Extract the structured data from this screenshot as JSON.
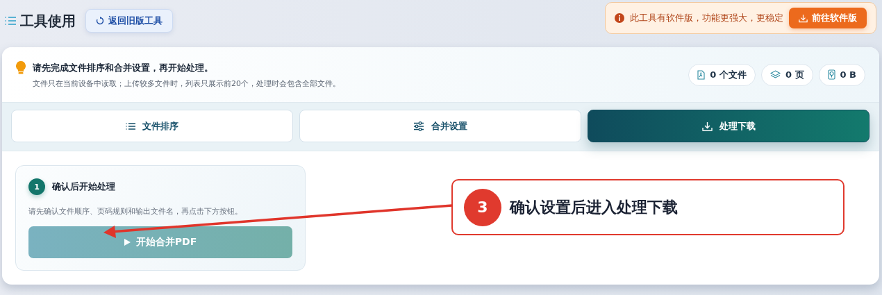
{
  "header": {
    "title": "工具使用",
    "back_button": "返回旧版工具",
    "notice": "此工具有软件版，功能更强大，更稳定",
    "notice_button": "前往软件版"
  },
  "intro": {
    "heading": "请先完成文件排序和合并设置，再开始处理。",
    "note": "文件只在当前设备中读取；上传较多文件时，列表只展示前20个，处理时会包含全部文件。",
    "stats": [
      {
        "kind": "files",
        "text": "0 个文件"
      },
      {
        "kind": "pages",
        "text": "0 页"
      },
      {
        "kind": "size",
        "text": "0 B"
      }
    ]
  },
  "tabs": [
    {
      "kind": "list",
      "label": "文件排序",
      "selected": false
    },
    {
      "kind": "sliders",
      "label": "合并设置",
      "selected": false
    },
    {
      "kind": "download",
      "label": "处理下载",
      "selected": true
    }
  ],
  "step": {
    "number": "1",
    "title": "确认后开始处理",
    "description": "请先确认文件顺序、页码规则和输出文件名，再点击下方按钮。",
    "button": {
      "label": "开始合并PDF",
      "disabled": true
    }
  },
  "annotation": {
    "number": "3",
    "text": "确认设置后进入处理下载"
  }
}
